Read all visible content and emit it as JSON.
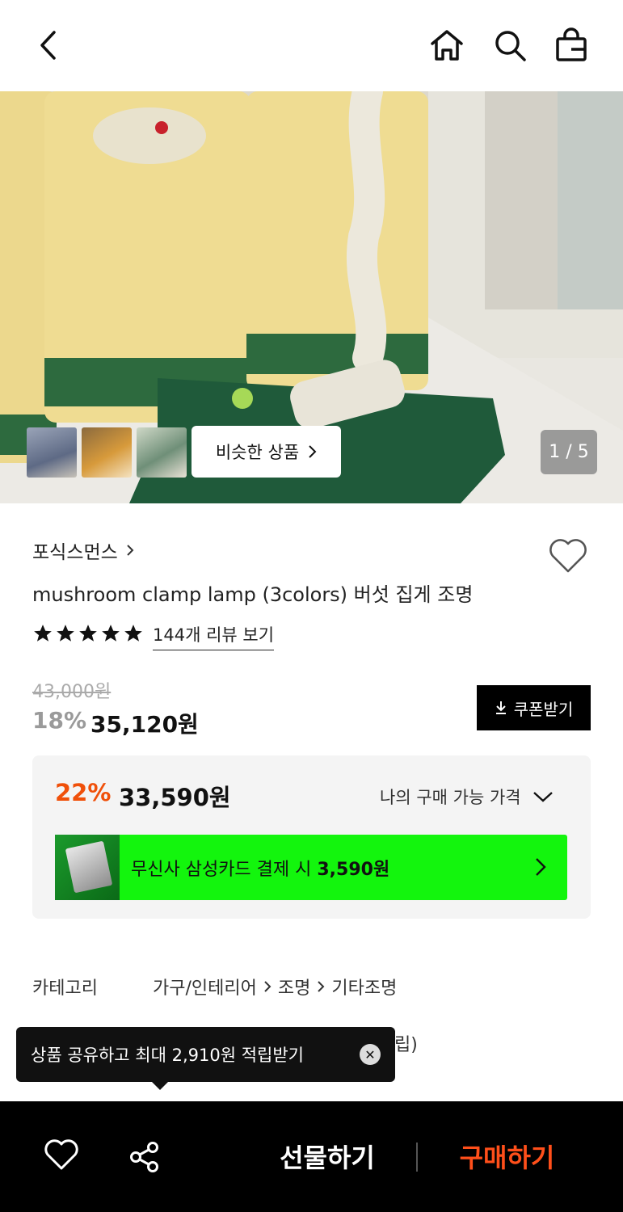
{
  "header": {
    "back_icon": "chevron-left-icon",
    "home_icon": "home-icon",
    "search_icon": "search-icon",
    "bag_icon": "shopping-bag-icon"
  },
  "gallery": {
    "similar_button_label": "비슷한 상품",
    "page_indicator": "1 / 5",
    "thumbnails": [
      "thumbnail-1",
      "thumbnail-2",
      "thumbnail-3"
    ]
  },
  "product": {
    "brand": "포식스먼스",
    "title": "mushroom clamp lamp (3colors) 버섯 집게 조명",
    "rating_stars": 5,
    "review_link": "144개 리뷰 보기"
  },
  "pricing": {
    "original_price": "43,000원",
    "discount_rate": "18%",
    "sale_price": "35,120원",
    "coupon_button": "쿠폰받기",
    "my_price_discount": "22%",
    "my_price": "33,590원",
    "my_price_label": "나의 구매 가능 가격",
    "card_banner_text": "무신사 삼성카드 결제 시 ",
    "card_banner_amount": "3,590원"
  },
  "info": {
    "category_label": "카테고리",
    "category_path": [
      "가구/인테리어",
      "조명",
      "기타조명"
    ],
    "partial_text": "립)"
  },
  "toast": {
    "message": "상품 공유하고 최대 2,910원 적립받기"
  },
  "bottom_bar": {
    "gift_label": "선물하기",
    "buy_label": "구매하기"
  },
  "colors": {
    "discount_orange": "#f0500a",
    "buy_orange": "#ff4f1a",
    "card_green": "#13f50d"
  }
}
